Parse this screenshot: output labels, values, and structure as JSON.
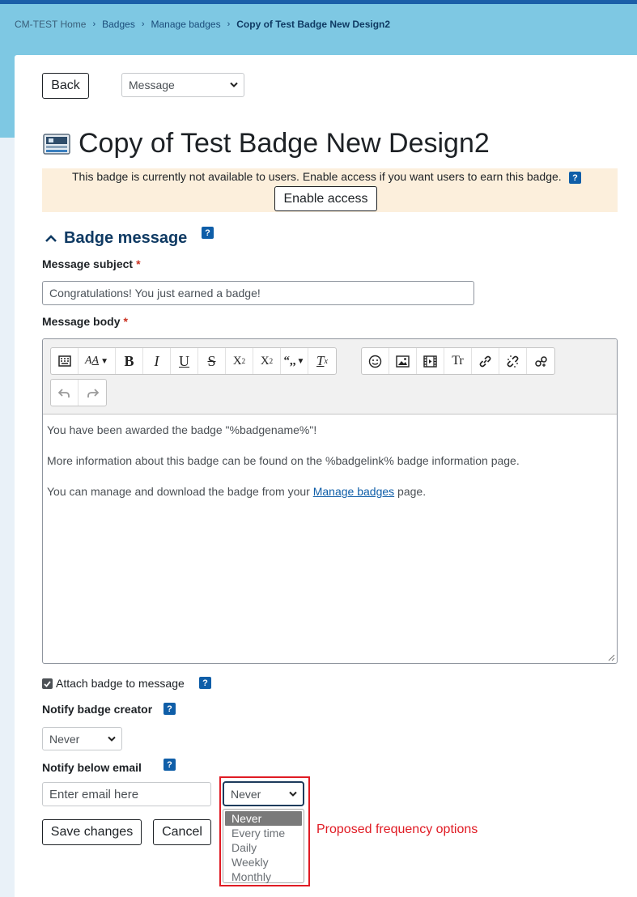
{
  "breadcrumb": {
    "items": [
      "CM-TEST Home",
      "Badges",
      "Manage badges",
      "Copy of Test Badge New Design2"
    ],
    "separator": "›"
  },
  "nav": {
    "back_label": "Back",
    "section_select_value": "Message"
  },
  "page": {
    "title": "Copy of Test Badge New Design2",
    "icon": "badge-icon"
  },
  "notice": {
    "text": "This badge is currently not available to users. Enable access if you want users to earn this badge.",
    "button_label": "Enable access",
    "help_glyph": "?"
  },
  "section": {
    "title": "Badge message",
    "help_glyph": "?"
  },
  "form": {
    "subject_label": "Message subject",
    "required_mark": "*",
    "subject_value": "Congratulations! You just earned a badge!",
    "body_label": "Message body",
    "body": {
      "line1": "You have been awarded the badge \"%badgename%\"!",
      "line2": "More information about this badge can be found on the %badgelink% badge information page.",
      "line3_before": "You can manage and download the badge from your ",
      "line3_link": "Manage badges",
      "line3_after": " page."
    },
    "toolbar_buttons": [
      "toggle-toolbar",
      "font-style",
      "bold",
      "italic",
      "underline",
      "strikethrough",
      "subscript",
      "superscript",
      "quote",
      "clear-formatting",
      "emoji",
      "image",
      "media",
      "text-transform",
      "link",
      "unlink",
      "manage-files",
      "undo",
      "redo"
    ],
    "attach_label": "Attach badge to message",
    "attach_checked": true,
    "notify_creator_label": "Notify badge creator",
    "notify_creator_value": "Never",
    "notify_email_label": "Notify below email",
    "email_placeholder": "Enter email here",
    "frequency_value": "Never",
    "frequency_options": [
      "Never",
      "Every time",
      "Daily",
      "Weekly",
      "Monthly"
    ],
    "save_label": "Save changes",
    "cancel_label": "Cancel"
  },
  "annotation": {
    "text": "Proposed frequency options",
    "color": "#e01b24"
  },
  "colors": {
    "header_bg": "#7ec8e3",
    "brand_dark": "#0f3a63",
    "help_bg": "#0f5ea8",
    "notice_bg": "#fcefdc",
    "required": "#ca3120"
  }
}
